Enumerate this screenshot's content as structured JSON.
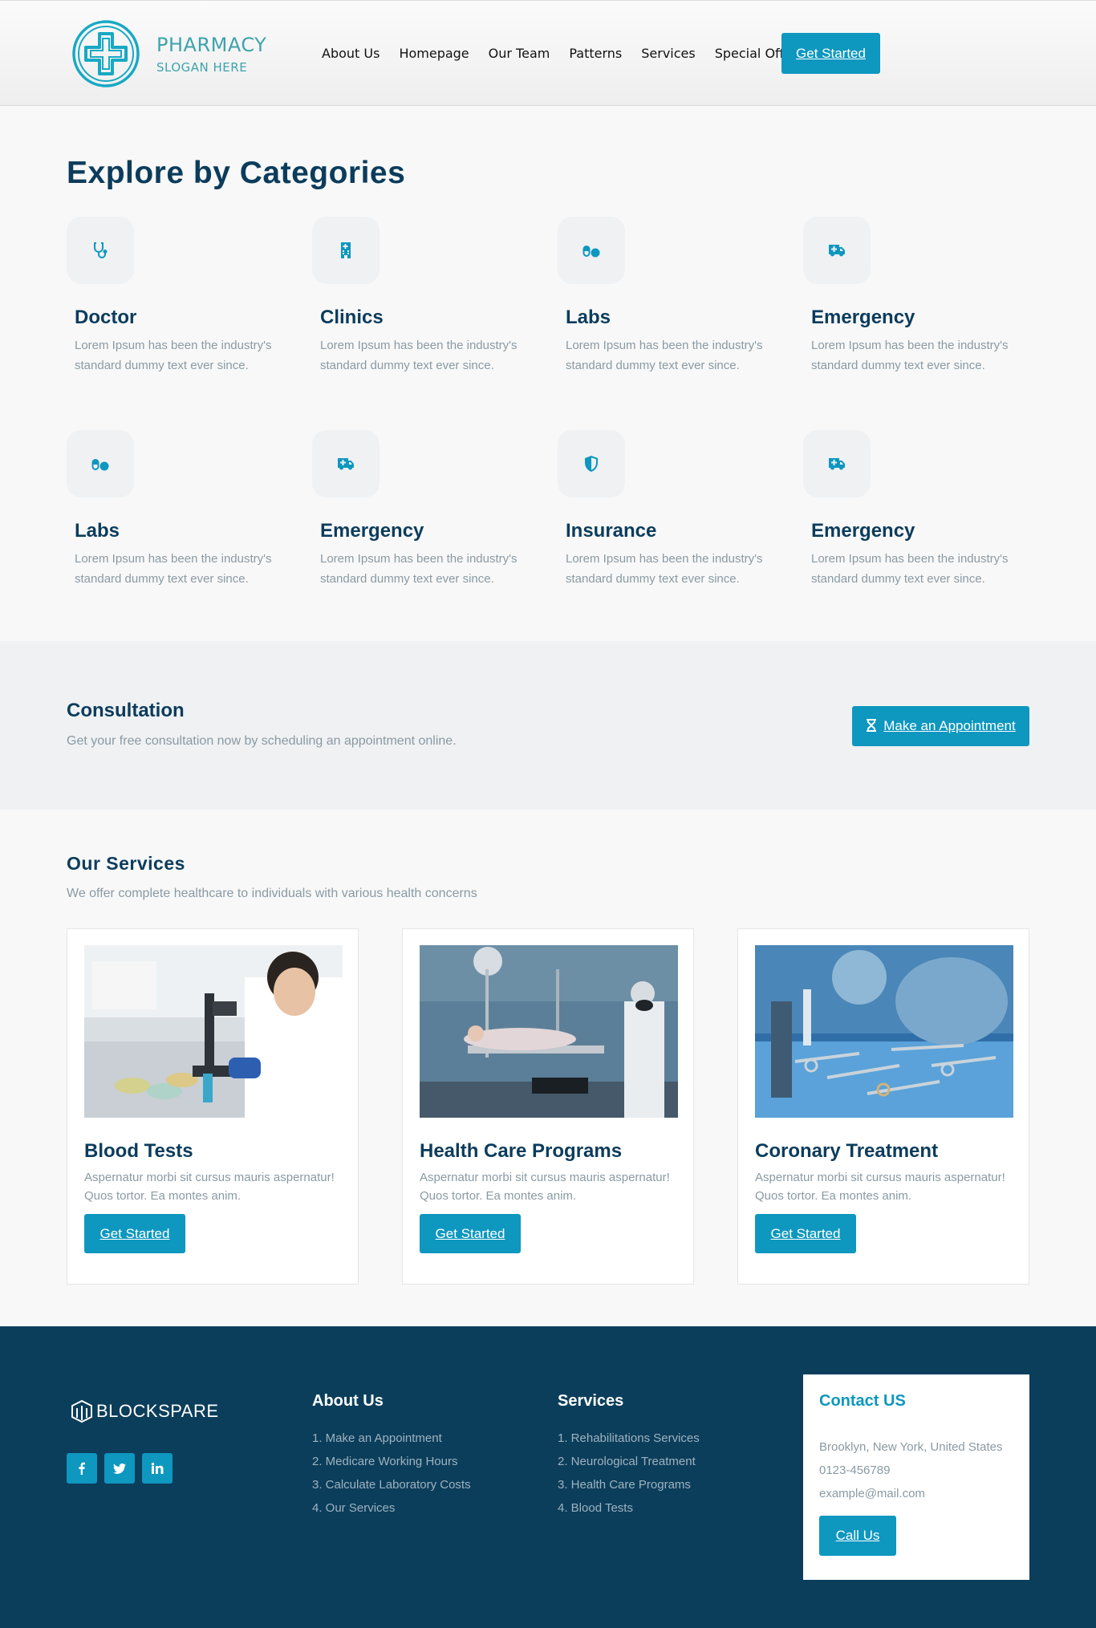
{
  "brand": {
    "title": "PHARMACY",
    "slogan": "SLOGAN HERE"
  },
  "nav": {
    "items": [
      "About Us",
      "Homepage",
      "Our Team",
      "Patterns",
      "Services",
      "Special Offer"
    ],
    "cta": "Get Started"
  },
  "categories": {
    "title": "Explore by Categories",
    "items": [
      {
        "icon": "stethoscope-icon",
        "name": "Doctor",
        "desc": "Lorem Ipsum has been the industry's standard dummy text ever since."
      },
      {
        "icon": "hospital-icon",
        "name": "Clinics",
        "desc": "Lorem Ipsum has been the industry's standard dummy text ever since."
      },
      {
        "icon": "pills-icon",
        "name": "Labs",
        "desc": "Lorem Ipsum has been the industry's standard dummy text ever since."
      },
      {
        "icon": "ambulance-icon",
        "name": "Emergency",
        "desc": "Lorem Ipsum has been the industry's standard dummy text ever since."
      },
      {
        "icon": "pills-icon",
        "name": "Labs",
        "desc": "Lorem Ipsum has been the industry's standard dummy text ever since."
      },
      {
        "icon": "ambulance-icon",
        "name": "Emergency",
        "desc": "Lorem Ipsum has been the industry's standard dummy text ever since."
      },
      {
        "icon": "shield-icon",
        "name": "Insurance",
        "desc": "Lorem Ipsum has been the industry's standard dummy text ever since."
      },
      {
        "icon": "ambulance-icon",
        "name": "Emergency",
        "desc": "Lorem Ipsum has been the industry's standard dummy text ever since."
      }
    ]
  },
  "consultation": {
    "title": "Consultation",
    "text": "Get your free consultation now by scheduling an appointment online.",
    "button": "Make an Appointment",
    "button_icon": "hourglass-icon"
  },
  "services": {
    "title": "Our Services",
    "subtitle": "We offer complete healthcare to individuals with various health concerns",
    "cards": [
      {
        "name": "Blood Tests",
        "desc": "Aspernatur morbi sit cursus mauris aspernatur! Quos tortor. Ea montes anim.",
        "button": "Get Started"
      },
      {
        "name": "Health Care Programs",
        "desc": "Aspernatur morbi sit cursus mauris aspernatur! Quos tortor. Ea montes anim.",
        "button": "Get Started"
      },
      {
        "name": "Coronary Treatment",
        "desc": "Aspernatur morbi sit cursus mauris aspernatur! Quos tortor. Ea montes anim.",
        "button": "Get Started"
      }
    ]
  },
  "footer": {
    "brand": "BLOCKSPARE",
    "socials": [
      "facebook-icon",
      "twitter-icon",
      "linkedin-icon"
    ],
    "about": {
      "title": "About Us",
      "items": [
        "1. Make an Appointment",
        "2. Medicare Working Hours",
        "3. Calculate Laboratory Costs",
        "4. Our Services"
      ]
    },
    "services": {
      "title": "Services",
      "items": [
        "1. Rehabilitations Services",
        "2. Neurological Treatment",
        "3. Health Care Programs",
        "4. Blood Tests"
      ]
    },
    "contact": {
      "title": "Contact US",
      "address": "Brooklyn, New York, United States",
      "phone": "0123-456789",
      "email": "example@mail.com",
      "button": "Call Us"
    }
  },
  "colors": {
    "accent": "#0e97bf",
    "navy": "#0c3c5c",
    "footer_bg": "#0b3e5b",
    "muted": "#8a9aa3",
    "logo": "#3ea3ad"
  }
}
